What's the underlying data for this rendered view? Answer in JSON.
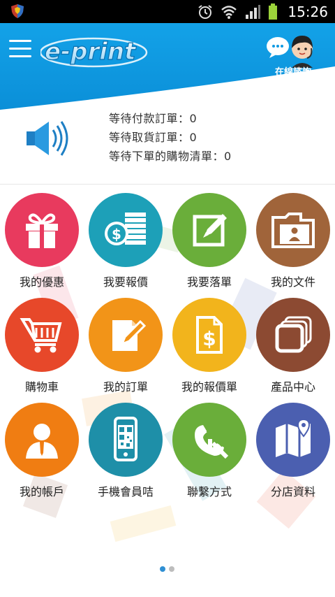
{
  "status_bar": {
    "time": "15:26",
    "icons": [
      "shield-app-icon",
      "alarm-icon",
      "wifi-icon",
      "signal-icon",
      "battery-icon"
    ]
  },
  "header": {
    "logo_text": "e-print",
    "consult_label": "在線諮詢",
    "colors": {
      "header_blue": "#0f9ae2",
      "header_dark": "#0a7cc0"
    }
  },
  "notice": {
    "lines": [
      "等待付款訂單：0",
      "等待取貨訂單：0",
      "等待下單的購物清單：0"
    ]
  },
  "menu": [
    {
      "label": "我的優惠",
      "icon": "gift-icon",
      "color": "#e83a5e"
    },
    {
      "label": "我要報價",
      "icon": "coins-icon",
      "color": "#1da0b8"
    },
    {
      "label": "我要落單",
      "icon": "edit-icon",
      "color": "#6aae3a"
    },
    {
      "label": "我的文件",
      "icon": "folder-icon",
      "color": "#a0643a"
    },
    {
      "label": "購物車",
      "icon": "cart-icon",
      "color": "#e7482a"
    },
    {
      "label": "我的訂單",
      "icon": "order-icon",
      "color": "#f29418"
    },
    {
      "label": "我的報價單",
      "icon": "quote-icon",
      "color": "#f2b41c"
    },
    {
      "label": "產品中心",
      "icon": "stack-icon",
      "color": "#8c4a32"
    },
    {
      "label": "我的帳戶",
      "icon": "user-icon",
      "color": "#f07d12"
    },
    {
      "label": "手機會員咭",
      "icon": "qr-phone-icon",
      "color": "#1e8fa8"
    },
    {
      "label": "聯繫方式",
      "icon": "phone-icon",
      "color": "#6aae3a"
    },
    {
      "label": "分店資料",
      "icon": "map-icon",
      "color": "#4b5fb0"
    }
  ],
  "pager": {
    "pages": 2,
    "active": 1
  }
}
